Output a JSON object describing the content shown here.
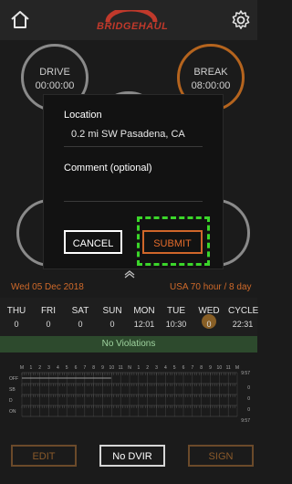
{
  "app": {
    "logo_text": "BRIDGEHAUL"
  },
  "status": {
    "drive_label": "DRIVE",
    "drive_time": "00:00:00",
    "break_label": "BREAK",
    "break_time": "08:00:00",
    "left_partial": "S",
    "left_time_partial": "0(",
    "right_time_partial": "2"
  },
  "modal": {
    "location_label": "Location",
    "location_value": "0.2 mi SW Pasadena, CA",
    "comment_label": "Comment (optional)",
    "comment_value": "",
    "cancel_label": "CANCEL",
    "submit_label": "SUBMIT"
  },
  "log": {
    "date": "Wed 05 Dec 2018",
    "cycle_rule": "USA 70 hour / 8 day",
    "days": [
      {
        "day": "THU",
        "value": "0"
      },
      {
        "day": "FRI",
        "value": "0"
      },
      {
        "day": "SAT",
        "value": "0"
      },
      {
        "day": "SUN",
        "value": "0"
      },
      {
        "day": "MON",
        "value": "12:01"
      },
      {
        "day": "TUE",
        "value": "10:30"
      },
      {
        "day": "WED",
        "value": "0"
      },
      {
        "day": "CYCLE",
        "value": "22:31"
      }
    ],
    "violations_text": "No Violations",
    "graph_rows": [
      "OFF",
      "SB",
      "D",
      "ON"
    ],
    "graph_totals": [
      "9:57",
      "0",
      "0",
      "0",
      "9:57"
    ],
    "graph_hours": [
      "M",
      "1",
      "2",
      "3",
      "4",
      "5",
      "6",
      "7",
      "8",
      "9",
      "10",
      "11",
      "N",
      "1",
      "2",
      "3",
      "4",
      "5",
      "6",
      "7",
      "8",
      "9",
      "10",
      "11",
      "M"
    ]
  },
  "actions": {
    "edit_label": "EDIT",
    "dvir_label": "No DVIR",
    "sign_label": "SIGN"
  },
  "colors": {
    "accent": "#e36b2b",
    "highlight": "#3bd62a",
    "violation_bg": "#2d4a2d"
  }
}
